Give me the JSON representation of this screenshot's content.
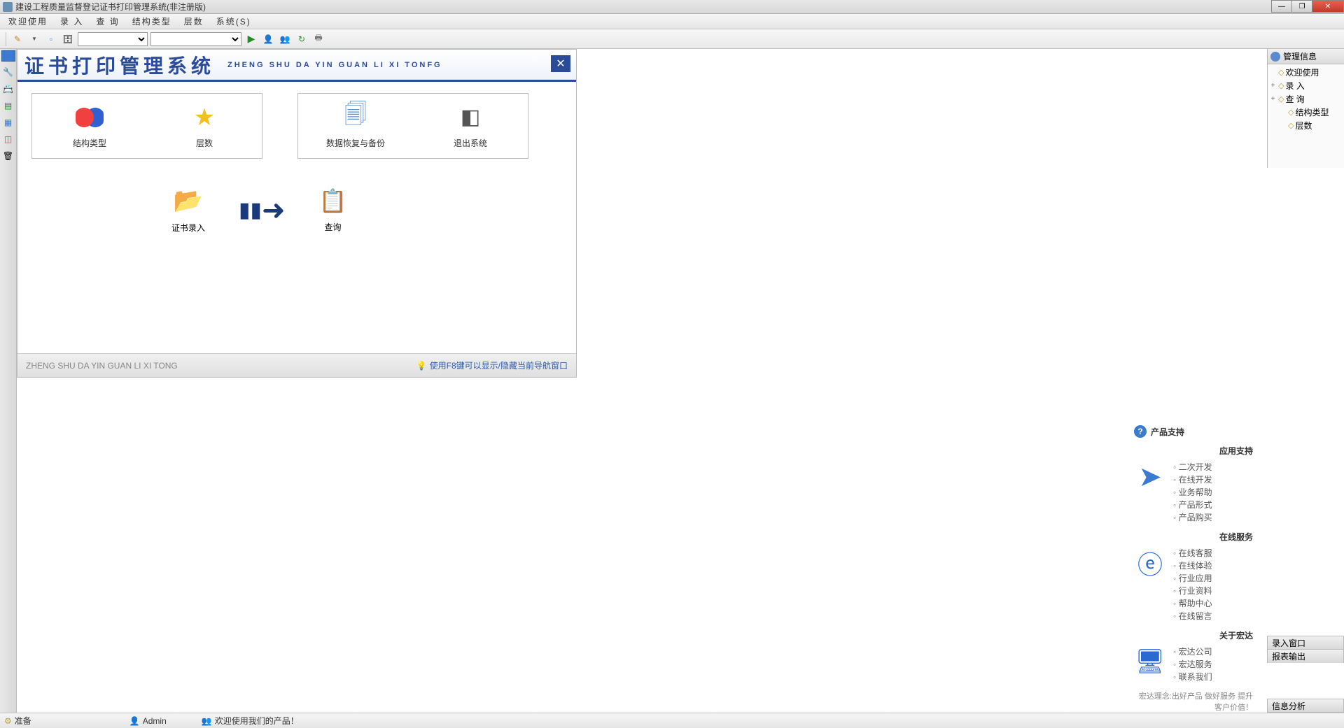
{
  "window": {
    "title": "建设工程质量监督登记证书打印管理系统(非注册版)"
  },
  "menu": {
    "items": [
      "欢迎使用",
      "录 入",
      "查 询",
      "结构类型",
      "层数",
      "系统(S)"
    ]
  },
  "welcome": {
    "ch_title": "证书打印管理系统",
    "en_title": "ZHENG SHU DA YIN GUAN LI XI TONFG",
    "tiles": {
      "structure": "结构类型",
      "layers": "层数",
      "backup": "数据恢复与备份",
      "exit": "退出系统",
      "input": "证书录入",
      "query": "查询"
    },
    "footer_left": "ZHENG SHU DA YIN GUAN LI XI TONG",
    "footer_hint": "使用F8键可以显示/隐藏当前导航窗口"
  },
  "support": {
    "title": "产品支持",
    "sections": [
      {
        "head": "应用支持",
        "items": [
          "二次开发",
          "在线开发",
          "业务帮助",
          "产品形式",
          "产品购买"
        ]
      },
      {
        "head": "在线服务",
        "items": [
          "在线客服",
          "在线体验",
          "行业应用",
          "行业资料",
          "帮助中心",
          "在线留言"
        ]
      },
      {
        "head": "关于宏达",
        "items": [
          "宏达公司",
          "宏达服务",
          "联系我们"
        ]
      }
    ],
    "slogan": "宏达理念:出好产品 做好服务 提升客户价值！"
  },
  "tree": {
    "title": "管理信息",
    "nodes": [
      {
        "label": "欢迎使用",
        "exp": ""
      },
      {
        "label": "录  入",
        "exp": "+"
      },
      {
        "label": "查  询",
        "exp": "+"
      },
      {
        "label": "结构类型",
        "exp": ""
      },
      {
        "label": "层数",
        "exp": ""
      }
    ]
  },
  "right_tabs": [
    "录入窗口",
    "报表输出",
    "信息分析"
  ],
  "statusbar": {
    "ready": "准备",
    "user": "Admin",
    "welcome": "欢迎使用我们的产品！"
  },
  "icons": {
    "pencil": "✎",
    "page": "▫",
    "db": "🗄",
    "play": "▶",
    "person": "👤",
    "persons": "👥",
    "refresh": "↻",
    "printer": "🖶",
    "close": "✕",
    "bulb": "💡",
    "arrow": "➡"
  }
}
